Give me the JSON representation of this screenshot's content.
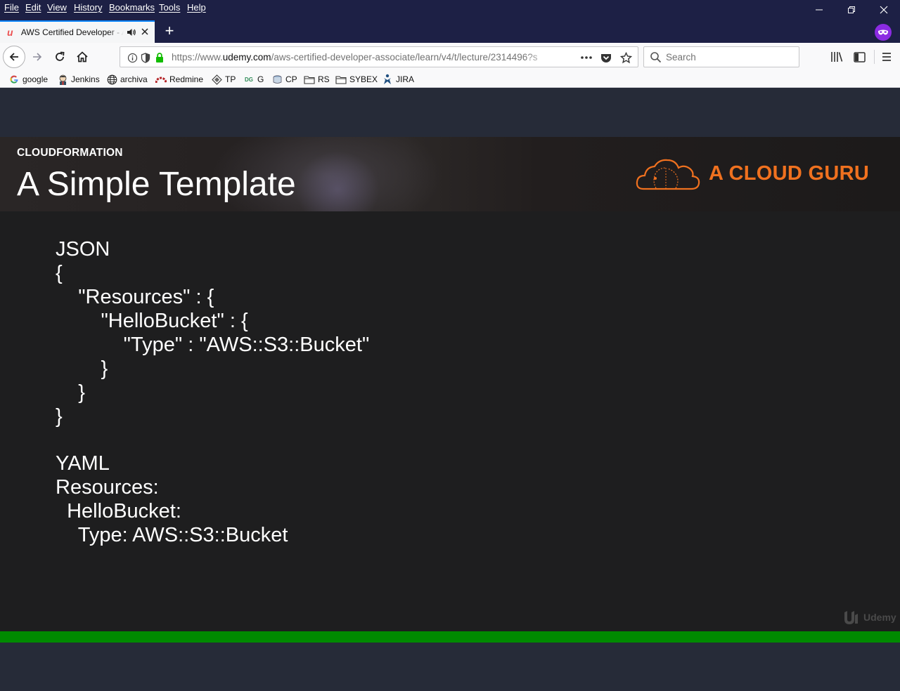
{
  "menubar": {
    "items": [
      "File",
      "Edit",
      "View",
      "History",
      "Bookmarks",
      "Tools",
      "Help"
    ]
  },
  "window_controls": {
    "minimize": "—",
    "restore": "❐",
    "close": "✕"
  },
  "tab": {
    "title": "AWS Certified Developer - A",
    "favicon": "udemy-u-icon",
    "new_tab": "+"
  },
  "navbar": {
    "url_prefix": "https://www.",
    "url_host": "udemy.com",
    "url_path": "/aws-certified-developer-associate/learn/v4/t/lecture/2314496?s",
    "search_placeholder": "Search"
  },
  "bookmarks": [
    {
      "label": "google",
      "icon": "google-icon"
    },
    {
      "label": "Jenkins",
      "icon": "jenkins-icon"
    },
    {
      "label": "archiva",
      "icon": "globe-icon"
    },
    {
      "label": "Redmine",
      "icon": "redmine-icon"
    },
    {
      "label": "TP",
      "icon": "tp-icon"
    },
    {
      "label": "G",
      "icon": "g-icon"
    },
    {
      "label": "CP",
      "icon": "cp-icon"
    },
    {
      "label": "RS",
      "icon": "folder-icon"
    },
    {
      "label": "SYBEX",
      "icon": "folder-icon"
    },
    {
      "label": "JIRA",
      "icon": "jira-icon"
    }
  ],
  "slide": {
    "kicker": "CLOUDFORMATION",
    "title": "A Simple Template",
    "brand": "A CLOUD GURU",
    "watermark": "Udemy",
    "json_heading": "JSON",
    "json_lines": [
      "{",
      "    \"Resources\" : {",
      "        \"HelloBucket\" : {",
      "            \"Type\" : \"AWS::S3::Bucket\"",
      "        }",
      "    }",
      "}"
    ],
    "yaml_heading": "YAML",
    "yaml_lines": [
      "Resources:",
      "  HelloBucket:",
      "    Type: AWS::S3::Bucket"
    ]
  },
  "colors": {
    "brand_orange": "#f0711f",
    "progress_green": "#008a00",
    "menubar_bg": "#1d2045"
  }
}
